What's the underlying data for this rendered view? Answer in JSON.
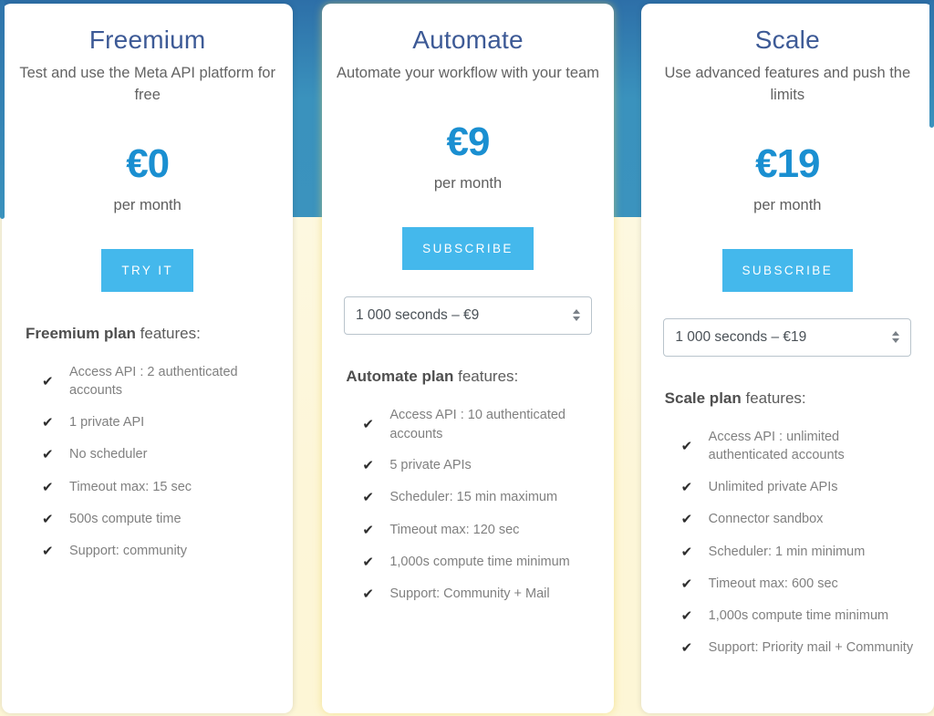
{
  "theme": {
    "accent_blue": "#44b8ec",
    "price_blue": "#1a8fd1",
    "title_blue": "#3d5a96",
    "band_blue": "#3a92bd",
    "highlight_cream": "#fdf6d8",
    "text_gray": "#808080"
  },
  "plans": [
    {
      "name": "Freemium",
      "tagline": "Test and use the Meta API platform for free",
      "price": "€0",
      "period": "per month",
      "cta_label": "TRY IT",
      "has_select": false,
      "select_value": "",
      "features_heading_strong": "Freemium plan",
      "features_heading_rest": " features:",
      "features": [
        "Access API : 2 authenticated accounts",
        "1 private API",
        "No scheduler",
        "Timeout max: 15 sec",
        "500s compute time",
        "Support: community"
      ]
    },
    {
      "name": "Automate",
      "tagline": "Automate your workflow with your team",
      "price": "€9",
      "period": "per month",
      "cta_label": "SUBSCRIBE",
      "has_select": true,
      "select_value": "1 000 seconds – €9",
      "features_heading_strong": "Automate plan",
      "features_heading_rest": " features:",
      "features": [
        "Access API : 10 authenticated accounts",
        "5 private APIs",
        "Scheduler: 15 min maximum",
        "Timeout max: 120 sec",
        "1,000s compute time minimum",
        "Support: Community + Mail"
      ]
    },
    {
      "name": "Scale",
      "tagline": "Use advanced features and push the limits",
      "price": "€19",
      "period": "per month",
      "cta_label": "SUBSCRIBE",
      "has_select": true,
      "select_value": "1 000 seconds – €19",
      "features_heading_strong": "Scale plan",
      "features_heading_rest": " features:",
      "features": [
        "Access API : unlimited authenticated accounts",
        "Unlimited private APIs",
        "Connector sandbox",
        "Scheduler: 1 min minimum",
        "Timeout max: 600 sec",
        "1,000s compute time minimum",
        "Support: Priority mail + Community"
      ]
    }
  ],
  "icons": {
    "check": "✔",
    "spinner_up": "▲",
    "spinner_down": "▼"
  }
}
